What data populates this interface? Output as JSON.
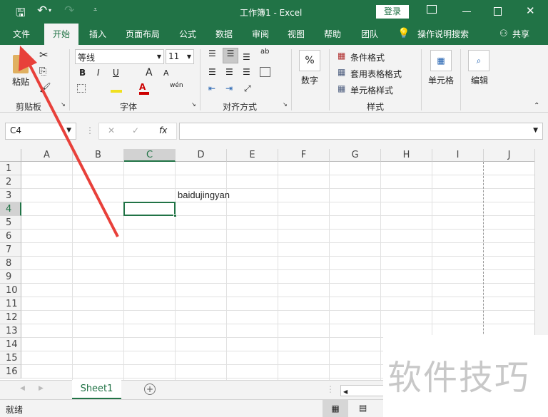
{
  "title_bar": {
    "title": "工作簿1  -  Excel",
    "login": "登录",
    "save_icon": "save-icon",
    "undo_icon": "undo-icon",
    "redo_icon": "redo-icon"
  },
  "tabs": [
    {
      "label": "文件"
    },
    {
      "label": "开始"
    },
    {
      "label": "插入"
    },
    {
      "label": "页面布局"
    },
    {
      "label": "公式"
    },
    {
      "label": "数据"
    },
    {
      "label": "审阅"
    },
    {
      "label": "视图"
    },
    {
      "label": "帮助"
    },
    {
      "label": "团队"
    },
    {
      "label": "操作说明搜索"
    },
    {
      "label": "共享"
    }
  ],
  "ribbon": {
    "clipboard": {
      "paste": "粘贴",
      "label": "剪贴板"
    },
    "font": {
      "name": "等线",
      "size": "11",
      "bold": "B",
      "italic": "I",
      "underline": "U",
      "grow": "A",
      "shrink": "A",
      "phonetic": "wén",
      "label": "字体"
    },
    "alignment": {
      "label": "对齐方式",
      "wrap": "ab"
    },
    "number": {
      "symbol": "%",
      "label": "数字"
    },
    "styles": {
      "conditional": "条件格式",
      "table": "套用表格格式",
      "cell": "单元格样式",
      "label": "样式"
    },
    "cells": {
      "label": "单元格"
    },
    "editing": {
      "label": "编辑"
    }
  },
  "formula_bar": {
    "name_box": "C4",
    "cancel": "✕",
    "enter": "✓",
    "fx": "fx",
    "value": ""
  },
  "columns": [
    "A",
    "B",
    "C",
    "D",
    "E",
    "F",
    "G",
    "H",
    "I",
    "J"
  ],
  "rows": [
    "1",
    "2",
    "3",
    "4",
    "5",
    "6",
    "7",
    "8",
    "9",
    "10",
    "11",
    "12",
    "13",
    "14",
    "15",
    "16"
  ],
  "cells": {
    "D3": "baidujingyan"
  },
  "selected_cell": "C4",
  "sheet_tabs": [
    {
      "label": "Sheet1"
    }
  ],
  "status": {
    "text": "就绪"
  },
  "watermark": "软件技巧",
  "colors": {
    "accent": "#217346",
    "arrow": "#e8403a"
  }
}
